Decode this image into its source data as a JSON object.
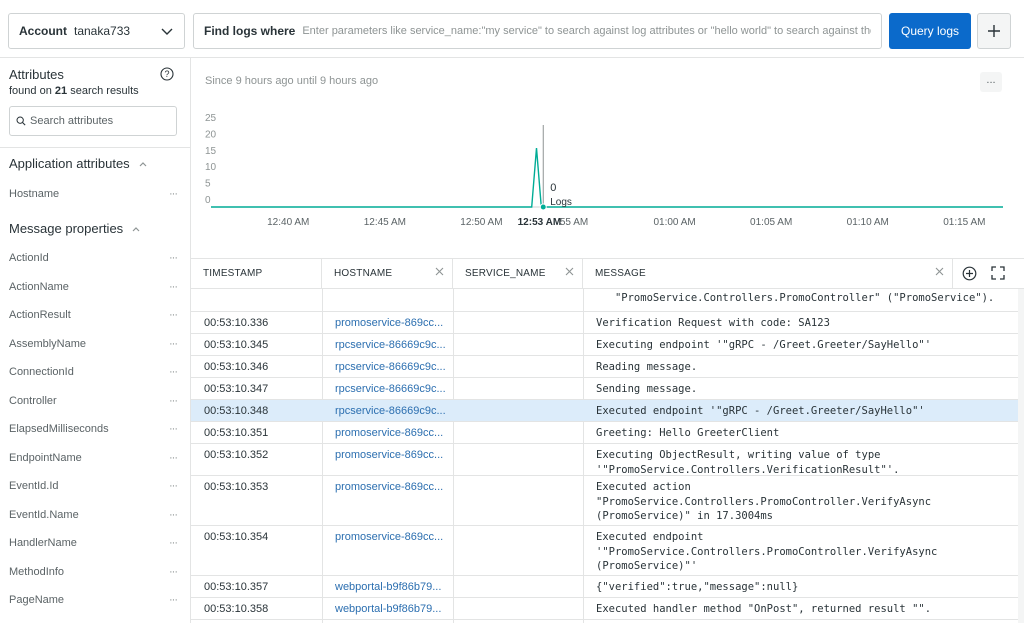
{
  "topbar": {
    "account_label": "Account",
    "account_value": "tanaka733",
    "query_label": "Find logs where",
    "query_placeholder": "Enter parameters like service_name:\"my service\" to search against log attributes or \"hello world\" to search against the message",
    "query_button": "Query logs"
  },
  "sidebar": {
    "title": "Attributes",
    "found_prefix": "found on",
    "found_count": "21",
    "found_suffix": "search results",
    "search_placeholder": "Search attributes",
    "sections": [
      {
        "title": "Application attributes",
        "items": [
          "Hostname"
        ]
      },
      {
        "title": "Message properties",
        "items": [
          "ActionId",
          "ActionName",
          "ActionResult",
          "AssemblyName",
          "ConnectionId",
          "Controller",
          "ElapsedMilliseconds",
          "EndpointName",
          "EventId.Id",
          "EventId.Name",
          "HandlerName",
          "MethodInfo",
          "PageName"
        ]
      }
    ]
  },
  "chart": {
    "subtitle": "Since 9 hours ago until 9 hours ago",
    "menu": "...",
    "tooltip_value": "0",
    "tooltip_series": "Logs"
  },
  "chart_data": {
    "type": "line",
    "title": "",
    "xlabel": "",
    "ylabel": "",
    "ylim": [
      0,
      25
    ],
    "y_ticks": [
      0,
      5,
      10,
      15,
      20,
      25
    ],
    "x_ticks": [
      "12:40 AM",
      "12:45 AM",
      "12:50 AM",
      "12:53 AM",
      "55 AM",
      "01:00 AM",
      "01:05 AM",
      "01:10 AM",
      "01:15 AM"
    ],
    "x_tick_minutes": [
      40,
      45,
      50,
      53,
      55,
      60,
      65,
      70,
      75
    ],
    "x_range_minutes": [
      36,
      77
    ],
    "series": [
      {
        "name": "Logs",
        "color": "#00ac96",
        "x": [
          36,
          52.6,
          52.85,
          53.1,
          77
        ],
        "values": [
          0,
          0,
          18,
          0,
          0
        ]
      }
    ],
    "grid": false,
    "legend": "none"
  },
  "table": {
    "columns": [
      "TIMESTAMP",
      "HOSTNAME",
      "SERVICE_NAME",
      "MESSAGE"
    ],
    "rows": [
      {
        "timestamp": "",
        "hostname": "",
        "message": "   \"PromoService.Controllers.PromoController\" (\"PromoService\").",
        "selected": false
      },
      {
        "timestamp": "00:53:10.336",
        "hostname": "promoservice-869cc...",
        "message": "Verification Request with code: SA123",
        "selected": false
      },
      {
        "timestamp": "00:53:10.345",
        "hostname": "rpcservice-86669c9c...",
        "message": "Executing endpoint '\"gRPC - /Greet.Greeter/SayHello\"'",
        "selected": false
      },
      {
        "timestamp": "00:53:10.346",
        "hostname": "rpcservice-86669c9c...",
        "message": "Reading message.",
        "selected": false
      },
      {
        "timestamp": "00:53:10.347",
        "hostname": "rpcservice-86669c9c...",
        "message": "Sending message.",
        "selected": false
      },
      {
        "timestamp": "00:53:10.348",
        "hostname": "rpcservice-86669c9c...",
        "message": "Executed endpoint '\"gRPC - /Greet.Greeter/SayHello\"'",
        "selected": true
      },
      {
        "timestamp": "00:53:10.351",
        "hostname": "promoservice-869cc...",
        "message": "Greeting: Hello GreeterClient",
        "selected": false
      },
      {
        "timestamp": "00:53:10.352",
        "hostname": "promoservice-869cc...",
        "message": "Executing ObjectResult, writing value of type\n'\"PromoService.Controllers.VerificationResult\"'.",
        "selected": false
      },
      {
        "timestamp": "00:53:10.353",
        "hostname": "promoservice-869cc...",
        "message": "Executed action\n\"PromoService.Controllers.PromoController.VerifyAsync\n(PromoService)\" in 17.3004ms",
        "selected": false
      },
      {
        "timestamp": "00:53:10.354",
        "hostname": "promoservice-869cc...",
        "message": "Executed endpoint\n'\"PromoService.Controllers.PromoController.VerifyAsync\n(PromoService)\"'",
        "selected": false
      },
      {
        "timestamp": "00:53:10.357",
        "hostname": "webportal-b9f86b79...",
        "message": "{\"verified\":true,\"message\":null}",
        "selected": false
      },
      {
        "timestamp": "00:53:10.358",
        "hostname": "webportal-b9f86b79...",
        "message": "Executed handler method \"OnPost\", returned result \"\".",
        "selected": false
      }
    ]
  },
  "colors": {
    "primary": "#0b6acb",
    "link": "#2c6fb0",
    "selected_row": "#dcecfa",
    "series": "#00ac96"
  }
}
